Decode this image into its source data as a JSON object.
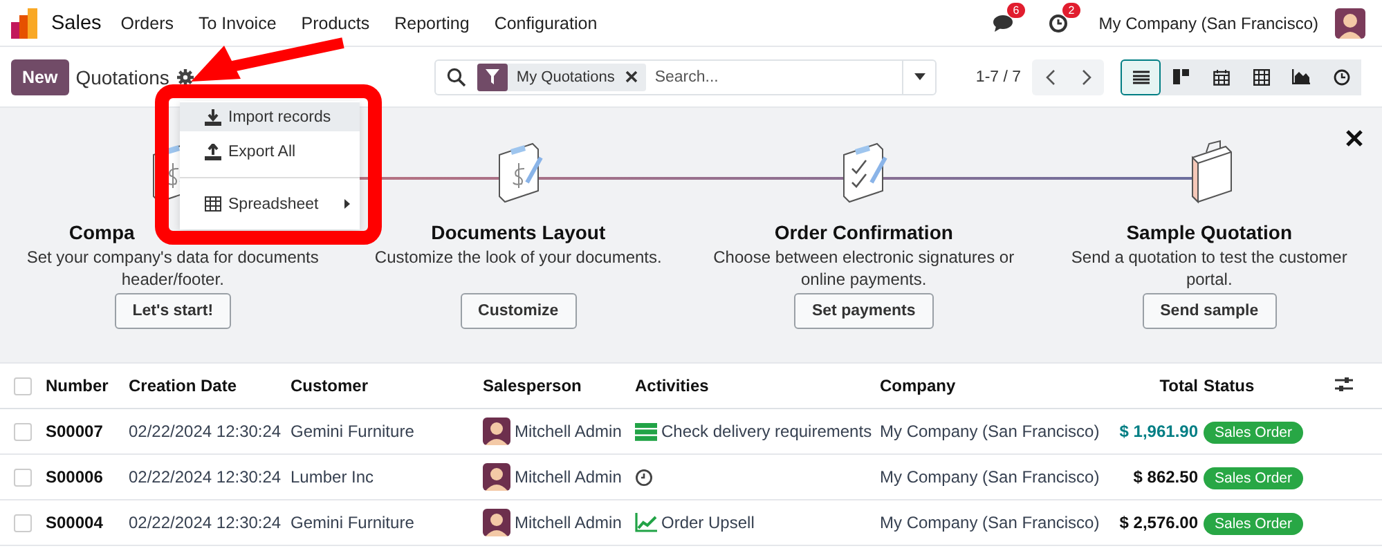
{
  "navbar": {
    "app_name": "Sales",
    "menu": [
      "Orders",
      "To Invoice",
      "Products",
      "Reporting",
      "Configuration"
    ],
    "messages_badge": "6",
    "activities_badge": "2",
    "company": "My Company (San Francisco)"
  },
  "control_panel": {
    "new_button": "New",
    "title": "Quotations",
    "search": {
      "facet": "My Quotations",
      "placeholder": "Search..."
    },
    "pager": "1-7 / 7",
    "views": [
      {
        "kind": "list",
        "selected": true
      },
      {
        "kind": "kanban",
        "selected": false
      },
      {
        "kind": "calendar",
        "selected": false
      },
      {
        "kind": "pivot",
        "selected": false
      },
      {
        "kind": "graph",
        "selected": false
      },
      {
        "kind": "activity",
        "selected": false
      }
    ]
  },
  "gear_menu": {
    "items": [
      {
        "kind": "import",
        "label": "Import records",
        "selected": true
      },
      {
        "kind": "export",
        "label": "Export All",
        "selected": false
      },
      {
        "kind": "spreadsheet",
        "label": "Spreadsheet",
        "selected": false
      }
    ]
  },
  "onboarding": {
    "steps": [
      {
        "kind": "company",
        "title": "Compa",
        "description": "Set your company's data for documents header/footer.",
        "button": "Let's start!"
      },
      {
        "kind": "layout",
        "title": "Documents Layout",
        "description": "Customize the look of your documents.",
        "button": "Customize"
      },
      {
        "kind": "confirmation",
        "title": "Order Confirmation",
        "description": "Choose between electronic signatures or online payments.",
        "button": "Set payments"
      },
      {
        "kind": "sample",
        "title": "Sample Quotation",
        "description": "Send a quotation to test the customer portal.",
        "button": "Send sample"
      }
    ]
  },
  "table": {
    "select_all_checked": false,
    "columns": [
      "Number",
      "Creation Date",
      "Customer",
      "Salesperson",
      "Activities",
      "Company",
      "Total",
      "Status"
    ],
    "rows": [
      {
        "checked": false,
        "number": "S00007",
        "date": "02/22/2024 12:30:24",
        "customer": "Gemini Furniture",
        "salesperson": "Mitchell Admin",
        "activity": {
          "kind": "todo",
          "label": "Check delivery requirements"
        },
        "company": "My Company (San Francisco)",
        "total": "$ 1,961.90",
        "highlighted": true,
        "status": "Sales Order"
      },
      {
        "checked": false,
        "number": "S00006",
        "date": "02/22/2024 12:30:24",
        "customer": "Lumber Inc",
        "salesperson": "Mitchell Admin",
        "activity": {
          "kind": "clock"
        },
        "company": "My Company (San Francisco)",
        "total": "$ 862.50",
        "highlighted": false,
        "status": "Sales Order"
      },
      {
        "checked": false,
        "number": "S00004",
        "date": "02/22/2024 12:30:24",
        "customer": "Gemini Furniture",
        "salesperson": "Mitchell Admin",
        "activity": {
          "kind": "upsell",
          "label": "Order Upsell"
        },
        "company": "My Company (San Francisco)",
        "total": "$ 2,576.00",
        "highlighted": false,
        "status": "Sales Order"
      }
    ]
  }
}
